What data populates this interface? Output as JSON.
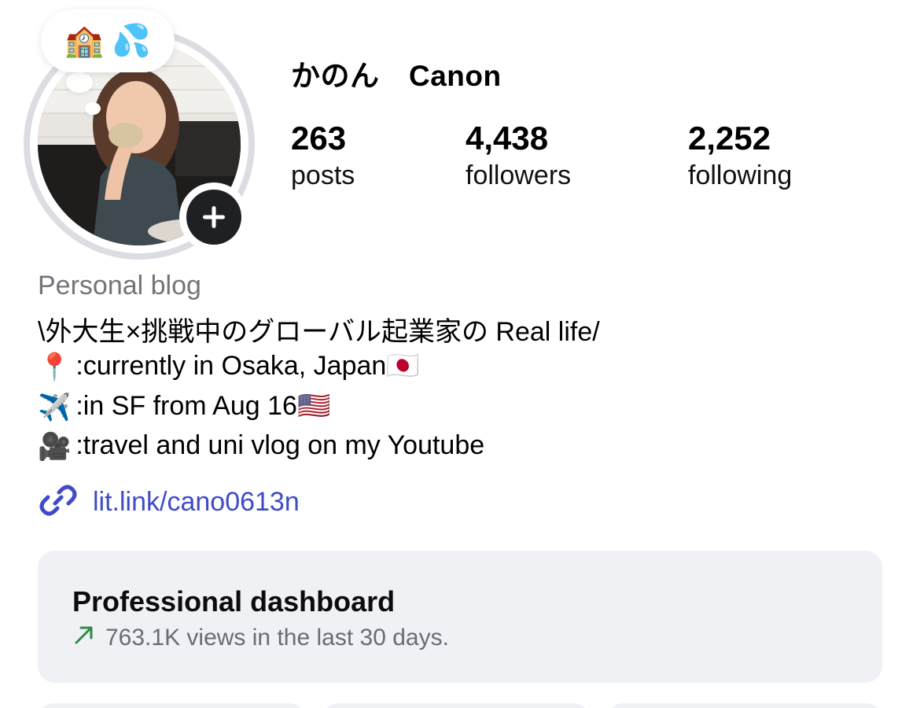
{
  "note": {
    "emojis": [
      "🏫",
      "💦"
    ]
  },
  "profile": {
    "display_name": "かのん　Canon",
    "category": "Personal blog"
  },
  "stats": [
    {
      "count": "263",
      "label": "posts"
    },
    {
      "count": "4,438",
      "label": "followers"
    },
    {
      "count": "2,252",
      "label": "following"
    }
  ],
  "bio": {
    "lines": [
      {
        "icon": "",
        "text": "\\外大生×挑戦中のグローバル起業家の Real life/"
      },
      {
        "icon": "📍",
        "text": ":currently in Osaka, Japan",
        "suffix": "🇯🇵"
      },
      {
        "icon": "✈️",
        "text": ":in SF from Aug 16",
        "suffix": "🇺🇸"
      },
      {
        "icon": "🎥",
        "text": ":travel and uni vlog on my Youtube"
      }
    ],
    "link": "lit.link/cano0613n"
  },
  "dashboard": {
    "title": "Professional dashboard",
    "subtitle": "763.1K views in the last 30 days."
  },
  "colors": {
    "link": "#3f4bc8",
    "trend_up": "#2e8a47",
    "muted_text": "#737479",
    "card_bg": "#f0f1f4"
  },
  "icons": {
    "link": "link-icon",
    "trend": "trend-up-arrow-icon",
    "add": "plus-icon"
  }
}
